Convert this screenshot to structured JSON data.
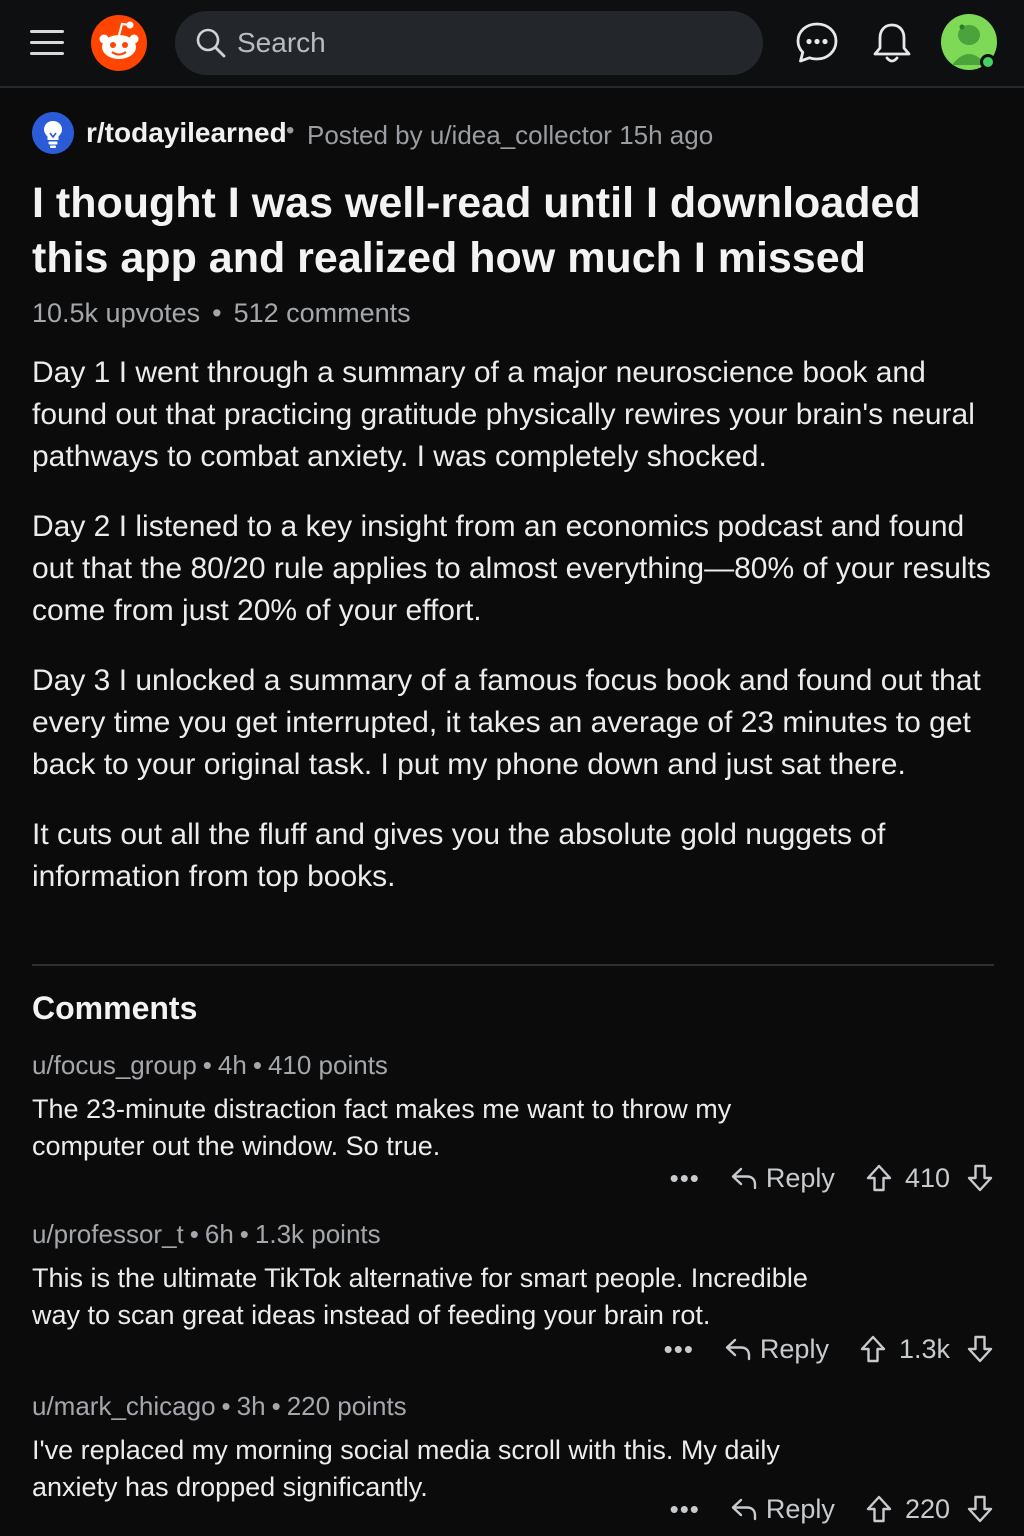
{
  "header": {
    "search_placeholder": "Search"
  },
  "post": {
    "subreddit": "r/todayilearned",
    "posted_by": "Posted by u/idea_collector 15h ago",
    "title": "I thought I was well-read until I downloaded this app and realized how much I missed",
    "upvotes": "10.5k upvotes",
    "comments_count": "512 comments",
    "paragraphs": [
      "Day 1 I went through a summary of a major neuroscience book and found out that practicing gratitude physically rewires your brain's neural pathways to combat anxiety. I was completely shocked.",
      "Day 2 I listened to a key insight from an economics podcast and found out that the 80/20 rule applies to almost everything—80% of your results come from just 20% of your effort.",
      "Day 3 I unlocked a summary of a famous focus book and found out that every time you get interrupted, it takes an average of 23 minutes to get back to your original task. I put my phone down and just sat there.",
      "It cuts out all the fluff and gives you the absolute gold nuggets of information from top books."
    ]
  },
  "comments_section": {
    "heading": "Comments",
    "reply_label": "Reply",
    "more_label": "•••",
    "items": [
      {
        "user": "u/focus_group",
        "age": "4h",
        "points": "410 points",
        "text": "The 23-minute distraction fact makes me want to throw my computer out the window. So true.",
        "score": "410"
      },
      {
        "user": "u/professor_t",
        "age": "6h",
        "points": "1.3k points",
        "text": "This is the ultimate TikTok alternative for smart people. Incredible way to scan great ideas instead of feeding your brain rot.",
        "score": "1.3k"
      },
      {
        "user": "u/mark_chicago",
        "age": "3h",
        "points": "220 points",
        "text": "I've replaced my morning social media scroll with this. My daily anxiety has dropped significantly.",
        "score": "220"
      }
    ]
  },
  "colors": {
    "background": "#0b0b0c",
    "brand_orange": "#ff4500",
    "subreddit_blue": "#2b5bd7",
    "avatar_green": "#7ed957"
  },
  "icons": [
    "menu-icon",
    "reddit-logo-icon",
    "search-icon",
    "chat-icon",
    "bell-icon",
    "avatar-icon",
    "lightbulb-icon",
    "reply-icon",
    "upvote-icon",
    "downvote-icon"
  ]
}
